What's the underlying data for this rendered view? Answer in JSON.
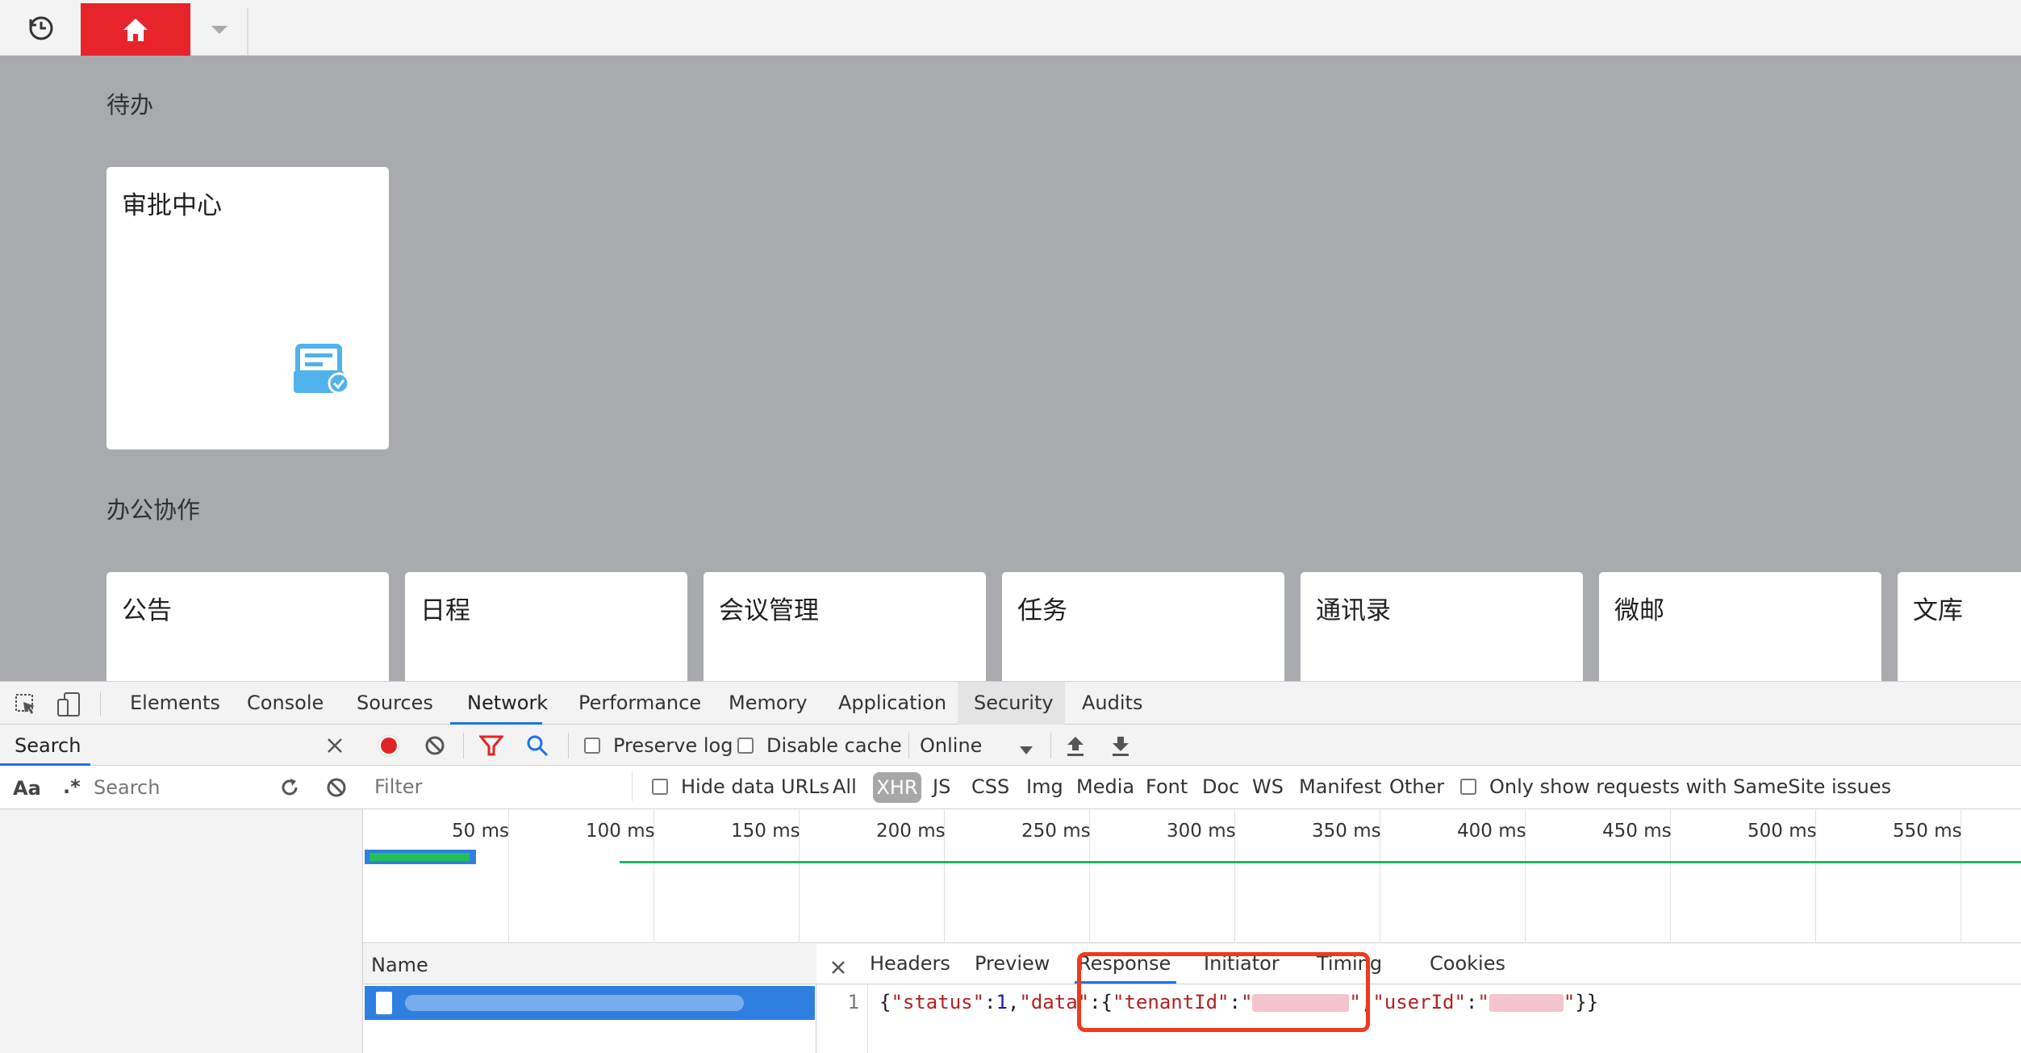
{
  "app": {
    "todo_section": "待办",
    "approval_card": "审批中心",
    "office_section": "办公协作",
    "office_cards": [
      "公告",
      "日程",
      "会议管理",
      "任务",
      "通讯录",
      "微邮",
      "文库"
    ]
  },
  "devtools": {
    "tabs": [
      "Elements",
      "Console",
      "Sources",
      "Network",
      "Performance",
      "Memory",
      "Application",
      "Security",
      "Audits"
    ],
    "active_tab": "Network",
    "search_panel": {
      "title": "Search",
      "aa_label": "Aa",
      "regex_label": ".*",
      "search_placeholder": "Search"
    },
    "toolbar": {
      "preserve_log": "Preserve log",
      "disable_cache": "Disable cache",
      "throttling": "Online"
    },
    "filter_bar": {
      "filter_placeholder": "Filter",
      "hide_data_urls": "Hide data URLs",
      "types": [
        "All",
        "XHR",
        "JS",
        "CSS",
        "Img",
        "Media",
        "Font",
        "Doc",
        "WS",
        "Manifest",
        "Other"
      ],
      "active_type": "XHR",
      "samesite": "Only show requests with SameSite issues"
    },
    "timeline_ticks": [
      "50 ms",
      "100 ms",
      "150 ms",
      "200 ms",
      "250 ms",
      "300 ms",
      "350 ms",
      "400 ms",
      "450 ms",
      "500 ms",
      "550 ms"
    ],
    "requests_header": "Name",
    "detail_tabs": [
      "Headers",
      "Preview",
      "Response",
      "Initiator",
      "Timing",
      "Cookies"
    ],
    "active_detail_tab": "Response",
    "response": {
      "line_number": "1",
      "tokens": [
        "{",
        "\"status\"",
        ":",
        "1",
        ",",
        "\"data\"",
        ":{",
        "\"tenantId\"",
        ":",
        "\"",
        "\"",
        ",",
        "\"userId\"",
        ":",
        "\"",
        "\"",
        "}}"
      ]
    }
  },
  "colors": {
    "brand_red": "#e8242b",
    "highlight_box": "#f0391d",
    "selected_row": "#2f7fe0",
    "devtools_blue": "#1a73e8"
  }
}
